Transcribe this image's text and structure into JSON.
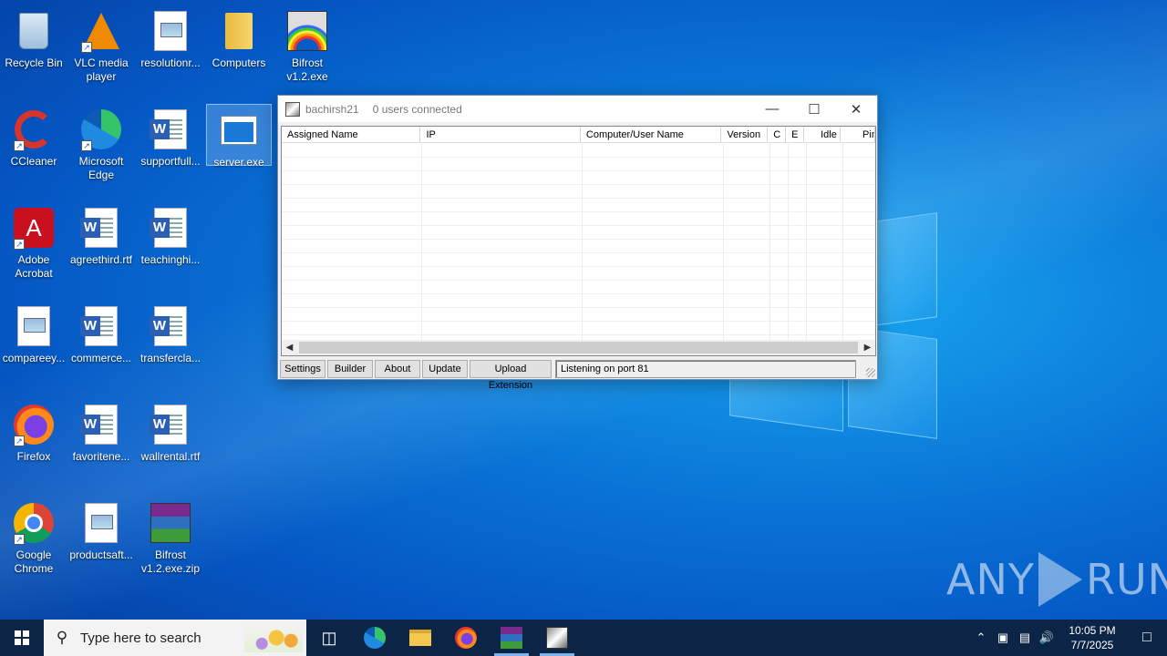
{
  "desktop": {
    "icons": [
      {
        "label": "Recycle Bin"
      },
      {
        "label": "VLC media player"
      },
      {
        "label": "resolutionr..."
      },
      {
        "label": "Computers"
      },
      {
        "label": "Bifrost v1.2.exe"
      },
      {
        "label": "CCleaner"
      },
      {
        "label": "Microsoft Edge"
      },
      {
        "label": "supportfull..."
      },
      {
        "label": "server.exe"
      },
      {
        "label": "Adobe Acrobat"
      },
      {
        "label": "agreethird.rtf"
      },
      {
        "label": "teachinghi..."
      },
      {
        "label": "compareey..."
      },
      {
        "label": "commerce..."
      },
      {
        "label": "transfercla..."
      },
      {
        "label": "Firefox"
      },
      {
        "label": "favoritene..."
      },
      {
        "label": "wallrental.rtf"
      },
      {
        "label": "Google Chrome"
      },
      {
        "label": "productsaft..."
      },
      {
        "label": "Bifrost v1.2.exe.zip"
      }
    ]
  },
  "window": {
    "title": "bachirsh21",
    "users_status": "0 users connected",
    "columns": [
      "Assigned Name",
      "IP",
      "Computer/User Name",
      "Version",
      "C",
      "E",
      "Idle",
      "Pin"
    ],
    "buttons": {
      "settings": "Settings",
      "builder": "Builder",
      "about": "About",
      "update": "Update",
      "upload": "Upload Extension"
    },
    "status": "Listening on port 81"
  },
  "watermark": {
    "left": "ANY",
    "right": "RUN"
  },
  "taskbar": {
    "search_placeholder": "Type here to search",
    "time": "10:05 PM",
    "date": "7/7/2025"
  }
}
